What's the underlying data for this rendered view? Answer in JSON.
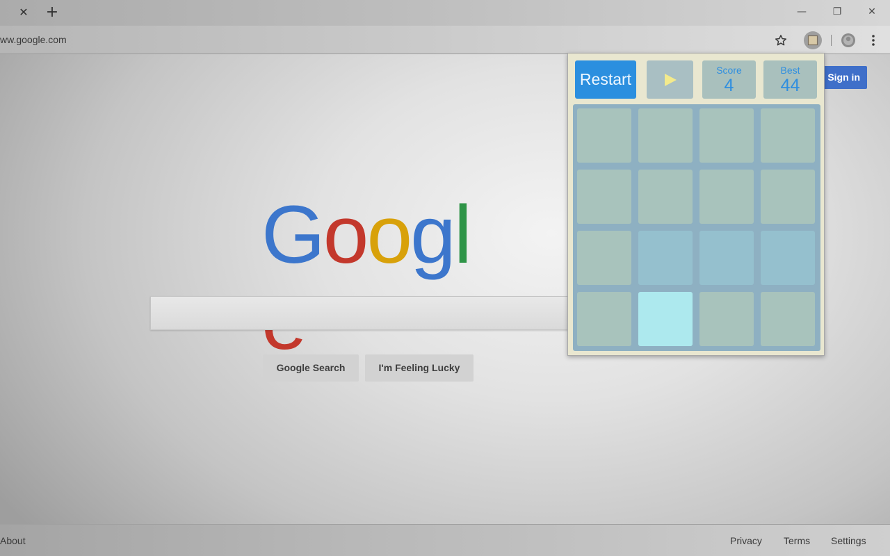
{
  "browser": {
    "tab_close_glyph": "✕",
    "new_tab_glyph": "+",
    "window_controls": [
      "—",
      "❐",
      "✕"
    ],
    "url": "ww.google.com",
    "toolbar_icons": [
      "star-icon",
      "extension-icon",
      "profile-icon",
      "menu-icon"
    ]
  },
  "google": {
    "sign_in_label": "Sign in",
    "logo_letters": [
      "G",
      "o",
      "o",
      "g",
      "l",
      "e"
    ],
    "logo_colors": [
      "#3c76cc",
      "#c3382c",
      "#d8a10a",
      "#3c76cc",
      "#2e9447",
      "#c3382c"
    ],
    "search_button_label": "Google Search",
    "lucky_button_label": "I'm Feeling Lucky",
    "footer": {
      "about": "About",
      "privacy": "Privacy",
      "terms": "Terms",
      "settings": "Settings"
    }
  },
  "game": {
    "restart_label": "Restart",
    "play_icon": "play-icon",
    "score_label": "Score",
    "score_value": "4",
    "best_label": "Best",
    "best_value": "44",
    "grid_rows": 4,
    "grid_cols": 4,
    "highlighted_tile": {
      "row": 3,
      "col": 1
    },
    "tinted_tiles": [
      {
        "row": 2,
        "col": 1
      },
      {
        "row": 2,
        "col": 2
      },
      {
        "row": 2,
        "col": 3
      }
    ]
  }
}
